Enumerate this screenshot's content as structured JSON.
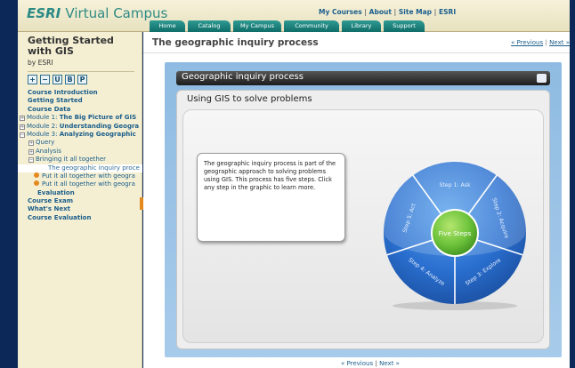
{
  "header": {
    "logo_brand": "ESRI",
    "logo_rest": "Virtual Campus",
    "top_links": [
      "My Courses",
      "About",
      "Site Map",
      "ESRI"
    ],
    "tabs": [
      "Home",
      "Catalog",
      "My Campus",
      "Community",
      "Library",
      "Support"
    ]
  },
  "sidebar": {
    "course_title": "Getting Started with GIS",
    "by": "by ESRI",
    "tool_icons": [
      "+",
      "−",
      "U",
      "B",
      "P"
    ],
    "items": [
      {
        "label": "Course Introduction"
      },
      {
        "label": "Getting Started"
      },
      {
        "label": "Course Data"
      },
      {
        "prefix": "Module 1: ",
        "label": "The Big Picture of GIS"
      },
      {
        "prefix": "Module 2: ",
        "label": "Understanding Geogra"
      },
      {
        "prefix": "Module 3: ",
        "label": "Analyzing Geographic"
      },
      {
        "label": "Query"
      },
      {
        "label": "Analysis"
      },
      {
        "label": "Bringing it all together"
      },
      {
        "label": "The geographic inquiry proce"
      },
      {
        "label": "Put it all together with geogra"
      },
      {
        "label": "Put it all together with geogra"
      },
      {
        "label": "Evaluation"
      },
      {
        "label": "Course Exam"
      },
      {
        "label": "What's Next"
      },
      {
        "label": "Course Evaluation"
      }
    ]
  },
  "main": {
    "page_title": "The geographic inquiry process",
    "prev_label": "« Previous",
    "separator": "|",
    "next_label": "Next »",
    "stage_title": "Geographic inquiry process",
    "panel_title": "Using GIS to solve problems",
    "info_text": "The geographic inquiry process is part of the geographic approach to solving problems using GIS. This process has five steps. Click any step in the graphic to learn more.",
    "wheel": {
      "center": "Five Steps",
      "steps": [
        "Step 1: Ask",
        "Step 2: Acquire",
        "Step 3: Explore",
        "Step 4: Analyze",
        "Step 5: Act"
      ]
    }
  },
  "colors": {
    "brand": "#2a8a86",
    "link": "#1b5e8c",
    "stage": "#8fbbe2",
    "wheel_blue": "#2a6fcf",
    "center_green": "#6cc23a"
  }
}
